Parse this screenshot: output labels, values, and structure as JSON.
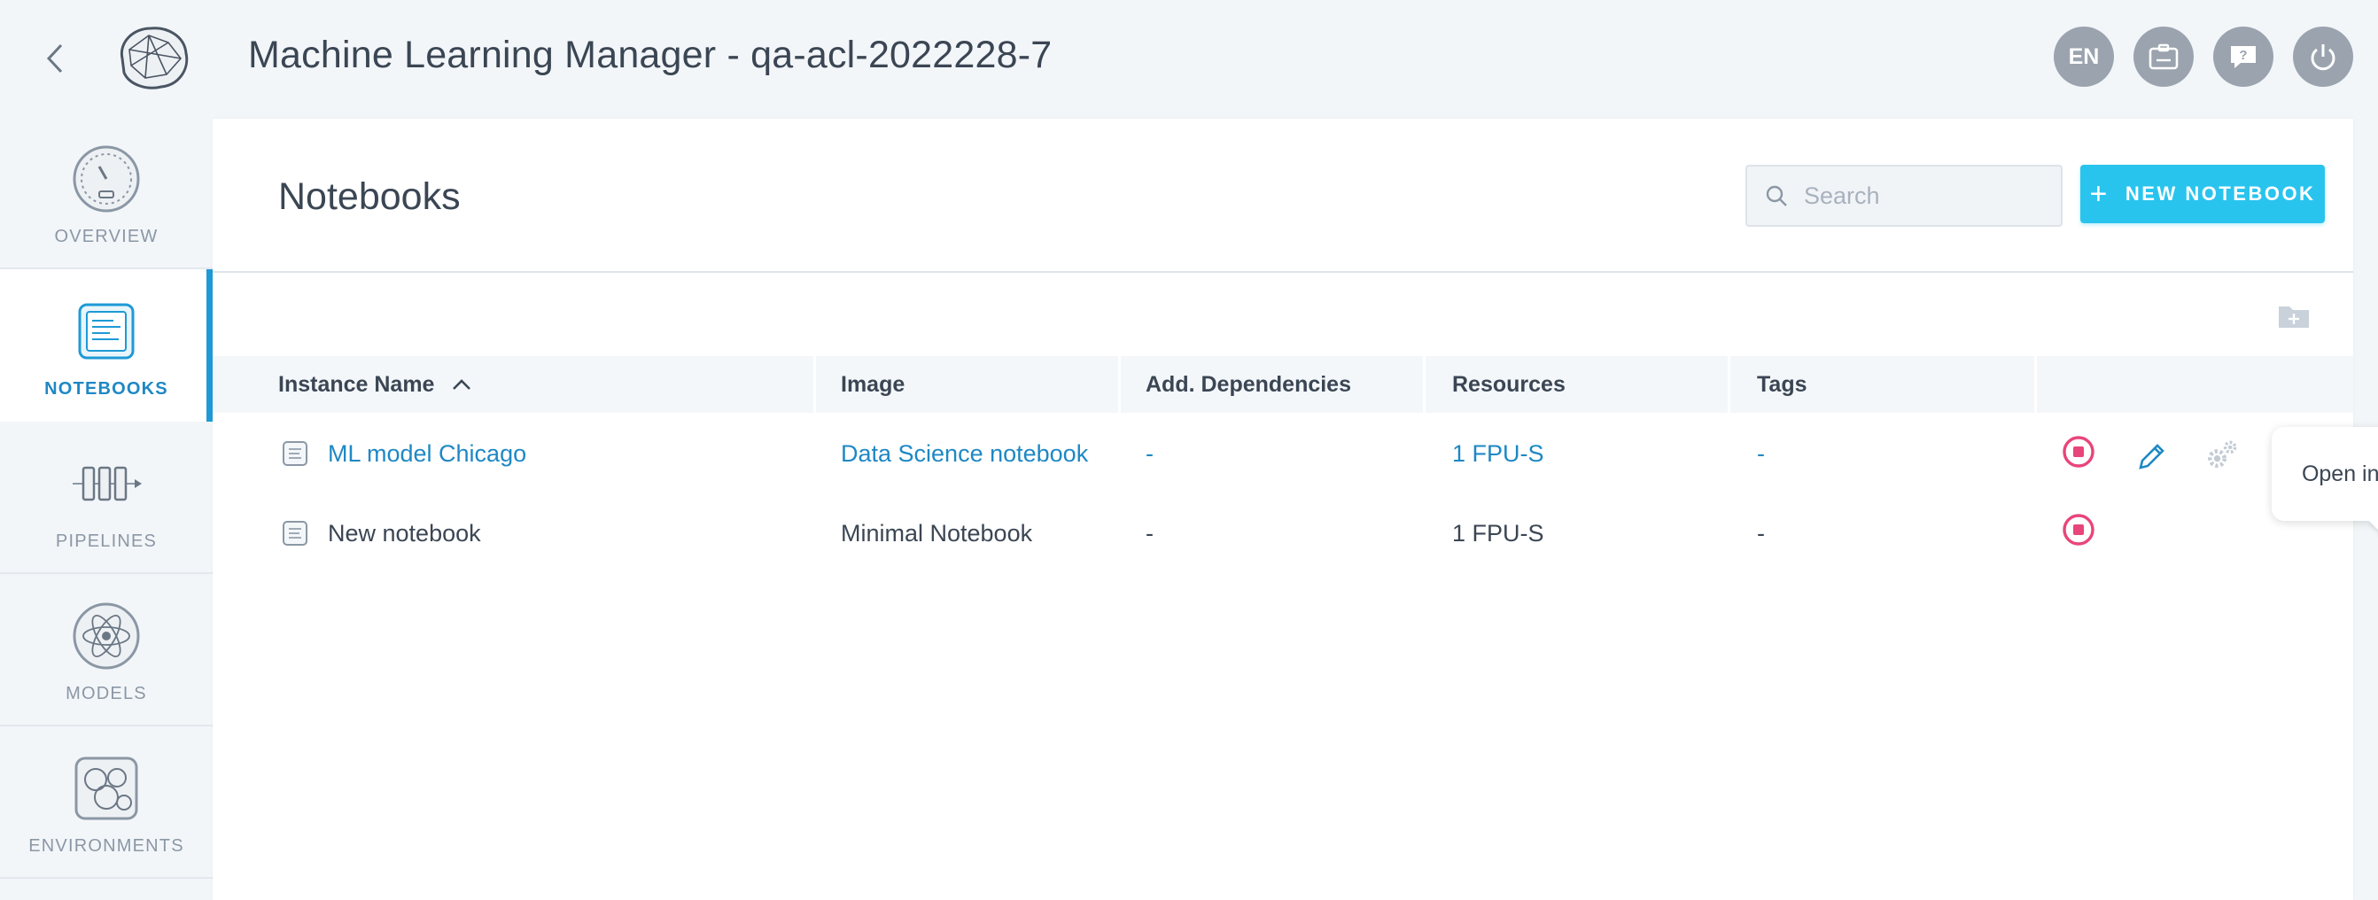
{
  "header": {
    "title": "Machine Learning Manager - qa-acl-2022228-7",
    "lang_label": "EN"
  },
  "sidebar": {
    "items": [
      {
        "label": "OVERVIEW",
        "icon": "gauge-icon"
      },
      {
        "label": "NOTEBOOKS",
        "icon": "notebook-icon",
        "active": true
      },
      {
        "label": "PIPELINES",
        "icon": "pipeline-icon"
      },
      {
        "label": "MODELS",
        "icon": "atom-icon"
      },
      {
        "label": "ENVIRONMENTS",
        "icon": "environment-icon"
      }
    ]
  },
  "main": {
    "title": "Notebooks",
    "search_placeholder": "Search",
    "new_button_label": "NEW NOTEBOOK",
    "table": {
      "columns": [
        "Instance Name",
        "Image",
        "Add. Dependencies",
        "Resources",
        "Tags"
      ],
      "rows": [
        {
          "name": "ML model Chicago",
          "image": "Data Science notebook",
          "deps": "-",
          "resources": "1 FPU-S",
          "tags": "-",
          "running": true
        },
        {
          "name": "New notebook",
          "image": "Minimal Notebook",
          "deps": "-",
          "resources": "1 FPU-S",
          "tags": "-",
          "running": false
        }
      ]
    },
    "tooltip": "Open in new tab"
  },
  "colors": {
    "accent": "#29c4ee",
    "link": "#1e88c4",
    "stop": "#e8457a",
    "header_btn": "#9aa3ae"
  }
}
